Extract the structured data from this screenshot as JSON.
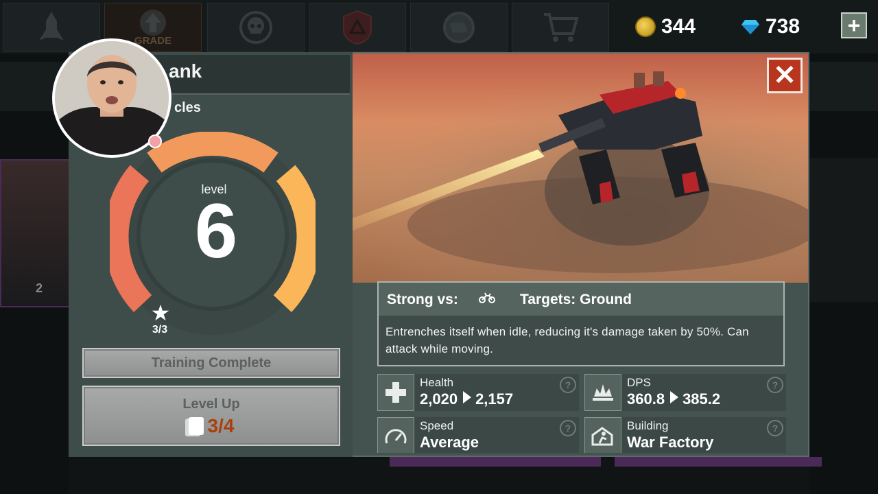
{
  "topbar": {
    "tabs": [
      {
        "name": "rocket",
        "label": ""
      },
      {
        "name": "upgrade",
        "label": "GRADE"
      },
      {
        "name": "skull",
        "label": ""
      },
      {
        "name": "hazard",
        "label": ""
      },
      {
        "name": "globe",
        "label": ""
      },
      {
        "name": "cart",
        "label": ""
      }
    ],
    "gold": "344",
    "gems": "738",
    "add_label": "+"
  },
  "unit": {
    "title": "ank",
    "category": "cles",
    "level_label": "level",
    "level": "6",
    "stars": "3/3",
    "training_label": "Training Complete",
    "level_up_label": "Level Up",
    "cards": "3/4"
  },
  "info": {
    "strong_vs": "Strong vs:",
    "targets": "Targets: Ground",
    "description": "Entrenches itself when idle, reducing it's damage taken by 50%. Can attack while moving."
  },
  "stats": {
    "health": {
      "label": "Health",
      "from": "2,020",
      "to": "2,157"
    },
    "dps": {
      "label": "DPS",
      "from": "360.8",
      "to": "385.2"
    },
    "speed": {
      "label": "Speed",
      "value": "Average"
    },
    "building": {
      "label": "Building",
      "value": "War Factory"
    },
    "help": "?"
  },
  "close_label": "✕",
  "side": {
    "left_count": "2"
  },
  "colors": {
    "gauge_start": "#e9705a",
    "gauge_end": "#fbb85a",
    "accent_orange": "#a9400c",
    "close_red": "#b8351e"
  }
}
